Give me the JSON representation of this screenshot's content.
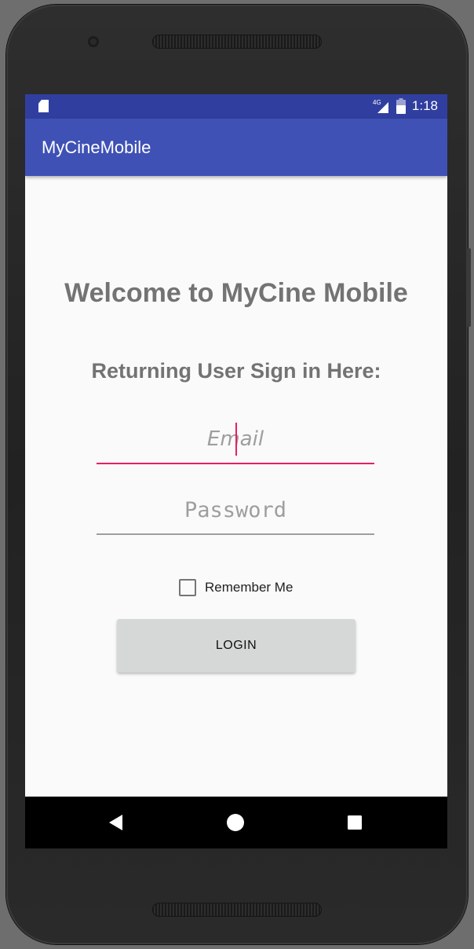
{
  "status_bar": {
    "network": "4G",
    "time": "1:18"
  },
  "app_bar": {
    "title": "MyCineMobile"
  },
  "main": {
    "welcome": "Welcome to MyCine Mobile",
    "subheading": "Returning User Sign in Here:",
    "email": {
      "value": "",
      "placeholder": "Email"
    },
    "password": {
      "value": "",
      "placeholder": "Password"
    },
    "remember_me": {
      "label": "Remember Me",
      "checked": false
    },
    "login_label": "LOGIN"
  },
  "navigation": {
    "icons": [
      "back-icon",
      "home-icon",
      "recent-apps-icon"
    ]
  },
  "colors": {
    "status_bar": "#303f9f",
    "app_bar": "#3f51b5",
    "accent": "#e91e63",
    "background": "#fafafa",
    "heading_text": "#737373",
    "button": "#d6d7d7"
  }
}
